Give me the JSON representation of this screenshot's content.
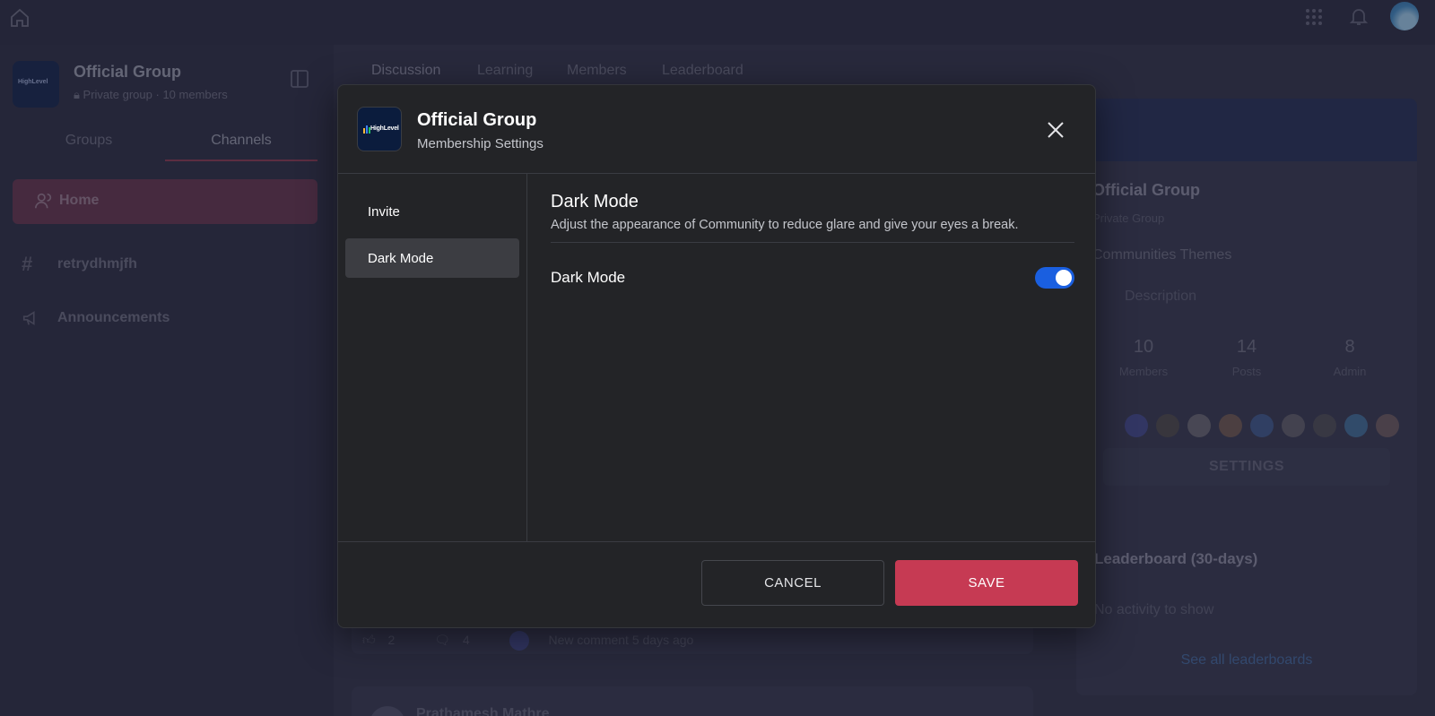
{
  "colors": {
    "accent_save": "#c63a53",
    "toggle_on": "#1a5fe0",
    "modal_bg": "#232427",
    "backdrop_tint": "#231e32"
  },
  "topbar": {
    "home_icon": "home-icon",
    "apps_icon": "grid-icon",
    "notifications_icon": "bell-icon",
    "avatar_icon": "avatar"
  },
  "sidebar": {
    "group_name": "Official Group",
    "group_privacy": "Private group",
    "group_members": "10 members",
    "logo_text": "HighLevel",
    "tabs": [
      "Groups",
      "Channels"
    ],
    "active_tab": "Channels",
    "items": [
      {
        "label": "Home",
        "icon": "users-icon"
      },
      {
        "label": "retrydhmjfh",
        "icon": "hash-icon"
      },
      {
        "label": "Announcements",
        "icon": "megaphone-icon"
      }
    ]
  },
  "main": {
    "tabs": [
      "Discussion",
      "Learning",
      "Members",
      "Leaderboard"
    ],
    "active_tab": "Discussion",
    "post": {
      "likes": "2",
      "comments": "4",
      "activity": "New comment 5 days ago",
      "next_author": "Prathamesh Mathre"
    }
  },
  "group_card": {
    "title": "Official Group",
    "privacy": "Private Group",
    "themes": "Communities Themes",
    "description": "Description",
    "stats": [
      {
        "value": "10",
        "label": "Members"
      },
      {
        "value": "14",
        "label": "Posts"
      },
      {
        "value": "8",
        "label": "Admin"
      }
    ],
    "settings_label": "SETTINGS"
  },
  "leaderboard": {
    "title": "Leaderboard (30-days)",
    "empty": "No activity to show",
    "link": "See all leaderboards"
  },
  "modal": {
    "title": "Official Group",
    "subtitle": "Membership Settings",
    "logo_text": "HighLevel",
    "menu": [
      {
        "label": "Invite",
        "active": false
      },
      {
        "label": "Dark Mode",
        "active": true
      }
    ],
    "section_title": "Dark Mode",
    "section_description": "Adjust the appearance of Community to reduce glare and give your eyes a break.",
    "toggle_label": "Dark Mode",
    "toggle_on": true,
    "cancel_label": "CANCEL",
    "save_label": "SAVE"
  }
}
